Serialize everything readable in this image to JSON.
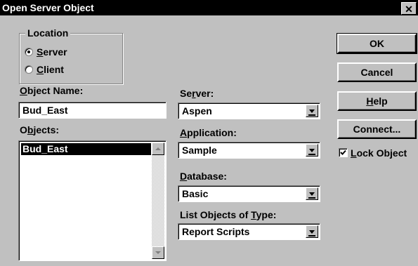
{
  "window": {
    "title": "Open Server Object",
    "close_glyph": "✕"
  },
  "location": {
    "group_label": "Location",
    "options": [
      {
        "prefix": "",
        "mnemonic": "S",
        "rest": "erver",
        "selected": true
      },
      {
        "prefix": "",
        "mnemonic": "C",
        "rest": "lient",
        "selected": false
      }
    ]
  },
  "object_name": {
    "label_mnemonic": "O",
    "label_rest": "bject Name:",
    "value": "Bud_East"
  },
  "objects": {
    "label_prefix": "O",
    "label_mnemonic": "b",
    "label_rest": "jects:",
    "items": [
      "Bud_East"
    ],
    "selected": "Bud_East"
  },
  "server": {
    "label_prefix": "Se",
    "label_mnemonic": "r",
    "label_rest": "ver:",
    "value": "Aspen"
  },
  "application": {
    "label_mnemonic": "A",
    "label_rest": "pplication:",
    "value": "Sample"
  },
  "database": {
    "label_mnemonic": "D",
    "label_rest": "atabase:",
    "value": "Basic"
  },
  "object_type": {
    "label_prefix": "List Objects of ",
    "label_mnemonic": "T",
    "label_rest": "ype:",
    "value": "Report Scripts"
  },
  "buttons": {
    "ok": "OK",
    "cancel": "Cancel",
    "help_mnemonic": "H",
    "help_rest": "elp",
    "connect": "Connect..."
  },
  "lock_object": {
    "mnemonic": "L",
    "rest": "ock Object",
    "checked": true
  },
  "icons": {
    "radio": "radio-icon",
    "dropdown": "dropdown-arrow-icon",
    "check": "checkmark-icon",
    "scroll_up": "scroll-up-icon",
    "scroll_down": "scroll-down-icon"
  }
}
